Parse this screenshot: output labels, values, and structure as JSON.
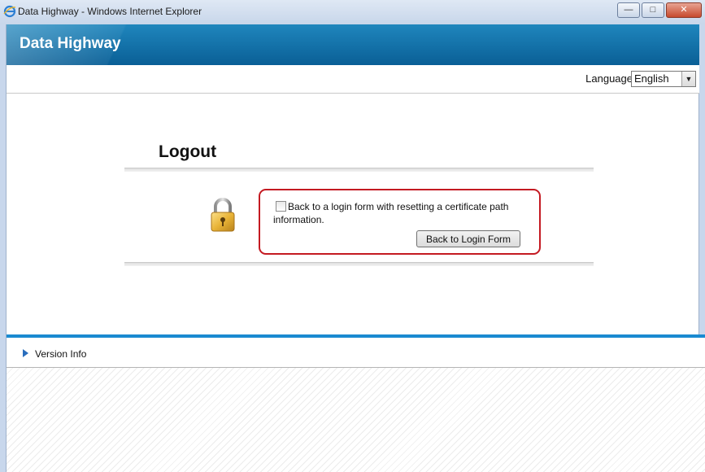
{
  "window": {
    "title": "Data Highway - Windows Internet Explorer"
  },
  "header": {
    "app_title": "Data Highway"
  },
  "language": {
    "label": "Language",
    "selected": "English"
  },
  "main": {
    "title": "Logout",
    "checkbox_label": "Back to a login form with resetting a certificate path information.",
    "checkbox_checked": false,
    "button_label": "Back to Login Form"
  },
  "footer": {
    "version_label": "Version Info"
  },
  "colors": {
    "header_blue": "#0a5f96",
    "highlight_red": "#c41a22",
    "accent_blue": "#1a8ad1"
  }
}
